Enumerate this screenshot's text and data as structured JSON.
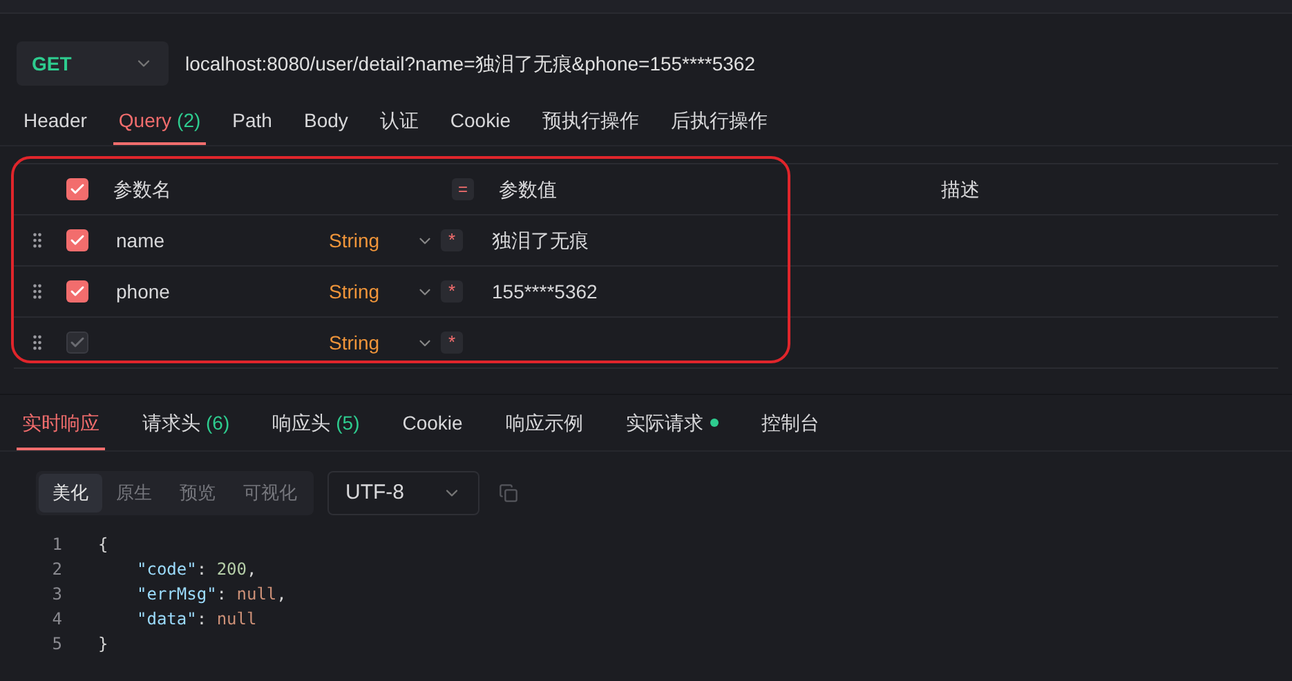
{
  "request": {
    "method": "GET",
    "url": "localhost:8080/user/detail?name=独泪了无痕&phone=155****5362"
  },
  "request_tabs": [
    {
      "label": "Header",
      "selected": false
    },
    {
      "label": "Query",
      "count": "(2)",
      "selected": true
    },
    {
      "label": "Path",
      "selected": false
    },
    {
      "label": "Body",
      "selected": false
    },
    {
      "label": "认证",
      "selected": false
    },
    {
      "label": "Cookie",
      "selected": false
    },
    {
      "label": "预执行操作",
      "selected": false
    },
    {
      "label": "后执行操作",
      "selected": false
    }
  ],
  "params": {
    "header": {
      "checked": true,
      "disabled": false,
      "name": "参数名",
      "equals": "=",
      "value": "参数值",
      "description": "描述"
    },
    "rows": [
      {
        "checked": true,
        "disabled": false,
        "name": "name",
        "type": "String",
        "required": "*",
        "value": "独泪了无痕"
      },
      {
        "checked": true,
        "disabled": false,
        "name": "phone",
        "type": "String",
        "required": "*",
        "value": "155****5362"
      },
      {
        "checked": true,
        "disabled": true,
        "name": "",
        "type": "String",
        "required": "*",
        "value": ""
      }
    ]
  },
  "response_tabs": [
    {
      "label": "实时响应",
      "selected": true
    },
    {
      "label": "请求头",
      "count": "(6)",
      "selected": false
    },
    {
      "label": "响应头",
      "count": "(5)",
      "selected": false
    },
    {
      "label": "Cookie",
      "selected": false
    },
    {
      "label": "响应示例",
      "selected": false
    },
    {
      "label": "实际请求",
      "dot": true,
      "selected": false
    },
    {
      "label": "控制台",
      "selected": false
    }
  ],
  "view_modes": [
    {
      "label": "美化",
      "selected": true
    },
    {
      "label": "原生",
      "selected": false
    },
    {
      "label": "预览",
      "selected": false
    },
    {
      "label": "可视化",
      "selected": false
    }
  ],
  "encoding": "UTF-8",
  "code_lines": [
    {
      "number": "1",
      "tokens": [
        {
          "text": "{",
          "kind": "punct"
        }
      ]
    },
    {
      "number": "2",
      "tokens": [
        {
          "text": "\"code\"",
          "kind": "key"
        },
        {
          "text": ": ",
          "kind": "punct"
        },
        {
          "text": "200",
          "kind": "number"
        },
        {
          "text": ",",
          "kind": "punct"
        }
      ]
    },
    {
      "number": "3",
      "tokens": [
        {
          "text": "\"errMsg\"",
          "kind": "key"
        },
        {
          "text": ": ",
          "kind": "punct"
        },
        {
          "text": "null",
          "kind": "null"
        },
        {
          "text": ",",
          "kind": "punct"
        }
      ]
    },
    {
      "number": "4",
      "tokens": [
        {
          "text": "\"data\"",
          "kind": "key"
        },
        {
          "text": ": ",
          "kind": "punct"
        },
        {
          "text": "null",
          "kind": "null"
        }
      ]
    },
    {
      "number": "5",
      "tokens": [
        {
          "text": "}",
          "kind": "punct"
        }
      ]
    }
  ]
}
